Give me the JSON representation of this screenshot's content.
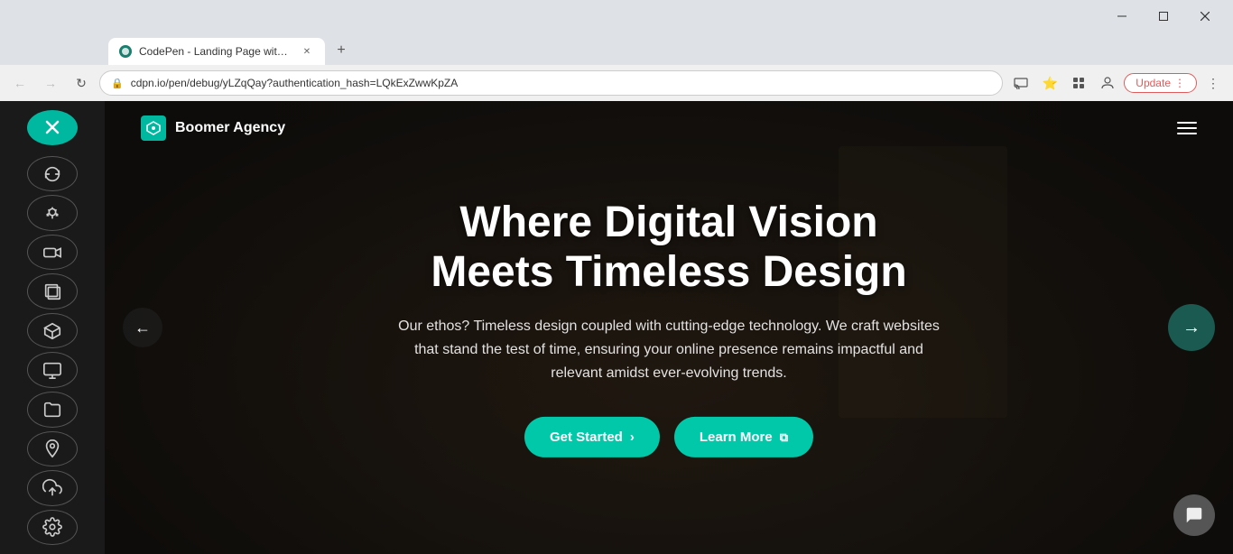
{
  "browser": {
    "tab": {
      "title": "CodePen - Landing Page with Ti...",
      "favicon": "C"
    },
    "address": "cdpn.io/pen/debug/yLZqQay?authentication_hash=LQkExZwwKpZA",
    "update_btn": "Update",
    "nav_back_disabled": true,
    "nav_forward_disabled": true
  },
  "sidebar": {
    "close_btn_label": "×",
    "tools": [
      {
        "name": "sync-icon",
        "symbol": "↻"
      },
      {
        "name": "bug-icon",
        "symbol": "🐛"
      },
      {
        "name": "video-icon",
        "symbol": "▭"
      },
      {
        "name": "copy-icon",
        "symbol": "⧉"
      },
      {
        "name": "box-icon",
        "symbol": "⬡"
      },
      {
        "name": "monitor-icon",
        "symbol": "▣"
      },
      {
        "name": "folder-icon",
        "symbol": "🗀"
      },
      {
        "name": "location-icon",
        "symbol": "◎"
      },
      {
        "name": "upload-icon",
        "symbol": "↑"
      },
      {
        "name": "settings-icon",
        "symbol": "⚙"
      }
    ]
  },
  "webpage": {
    "nav": {
      "logo_text": "Boomer Agency"
    },
    "hero": {
      "title_line1": "Where Digital Vision",
      "title_line2": "Meets Timeless Design",
      "subtitle": "Our ethos? Timeless design coupled with cutting-edge technology. We craft websites that stand the test of time, ensuring your online presence remains impactful and relevant amidst ever-evolving trends.",
      "btn_primary": "Get Started",
      "btn_primary_icon": "›",
      "btn_secondary": "Learn More",
      "btn_secondary_icon": "⧉"
    }
  }
}
